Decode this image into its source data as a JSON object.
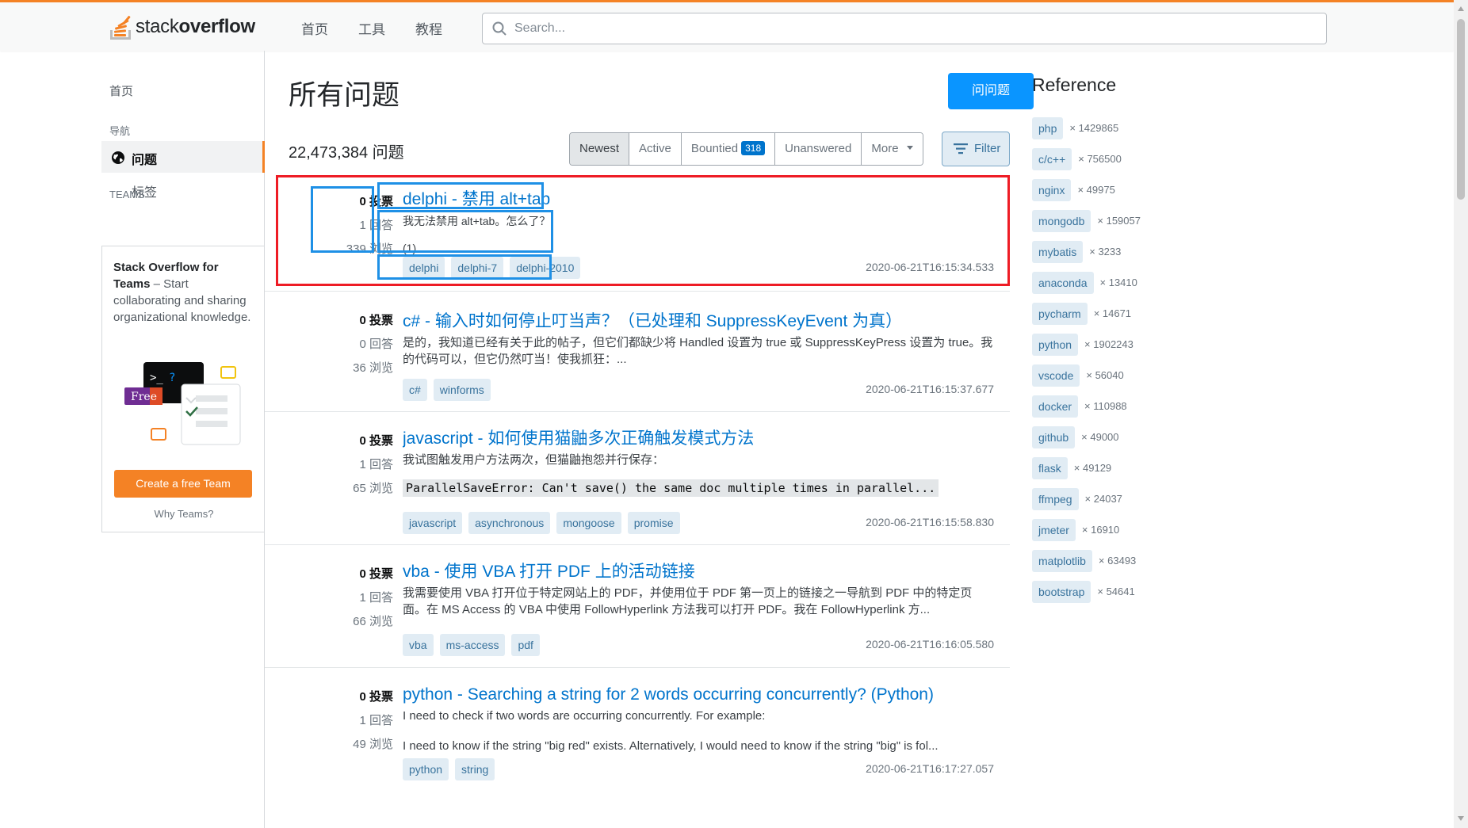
{
  "header": {
    "logo_text_1": "stack",
    "logo_text_2": "overflow",
    "nav": [
      "首页",
      "工具",
      "教程"
    ],
    "search_placeholder": "Search..."
  },
  "sidebar": {
    "home": "首页",
    "nav_section": "导航",
    "questions": "问题",
    "tags": "标签",
    "teams_section": "TEAMS",
    "teams_title": "Stack Overflow for Teams",
    "teams_desc": " – Start collaborating and sharing organizational knowledge.",
    "free_badge": "Free",
    "create_team": "Create a free Team",
    "why_teams": "Why Teams?"
  },
  "main": {
    "title": "所有问题",
    "ask_button": "问问题",
    "question_count": "22,473,384 问题",
    "filters": {
      "newest": "Newest",
      "active": "Active",
      "bountied": "Bountied",
      "bountied_count": "318",
      "unanswered": "Unanswered",
      "more": "More"
    },
    "filter_button": "Filter"
  },
  "questions": [
    {
      "votes": "0 投票",
      "answers": "1 回答",
      "views": "339 浏览",
      "title": "delphi - 禁用 alt+tab",
      "excerpt_1": "我无法禁用 alt+tab。怎么了？",
      "excerpt_2": "(1)...",
      "tags": [
        "delphi",
        "delphi-7",
        "delphi-2010"
      ],
      "date": "2020-06-21T16:15:34.533"
    },
    {
      "votes": "0 投票",
      "answers": "0 回答",
      "views": "36 浏览",
      "title": "c# - 输入时如何停止叮当声？（已处理和 SuppressKeyEvent 为真）",
      "excerpt_1": "是的，我知道已经有关于此的帖子，但它们都缺少将 Handled 设置为 true 或 SuppressKeyPress 设置为 true。我的代码可以，但它仍然叮当！使我抓狂：...",
      "tags": [
        "c#",
        "winforms"
      ],
      "date": "2020-06-21T16:15:37.677"
    },
    {
      "votes": "0 投票",
      "answers": "1 回答",
      "views": "65 浏览",
      "title": "javascript - 如何使用猫鼬多次正确触发模式方法",
      "excerpt_1": "我试图触发用户方法两次，但猫鼬抱怨并行保存：",
      "code": "ParallelSaveError: Can't save() the same doc multiple times in parallel...",
      "tags": [
        "javascript",
        "asynchronous",
        "mongoose",
        "promise"
      ],
      "date": "2020-06-21T16:15:58.830"
    },
    {
      "votes": "0 投票",
      "answers": "1 回答",
      "views": "66 浏览",
      "title": "vba - 使用 VBA 打开 PDF 上的活动链接",
      "excerpt_1": "我需要使用 VBA 打开位于特定网站上的 PDF，并使用位于 PDF 第一页上的链接之一导航到 PDF 中的特定页面。在 MS Access 的 VBA 中使用 FollowHyperlink 方法我可以打开 PDF。我在 FollowHyperlink 方...",
      "tags": [
        "vba",
        "ms-access",
        "pdf"
      ],
      "date": "2020-06-21T16:16:05.580"
    },
    {
      "votes": "0 投票",
      "answers": "1 回答",
      "views": "49 浏览",
      "title": "python - Searching a string for 2 words occurring concurrently? (Python)",
      "excerpt_1": "I need to check if two words are occurring concurrently. For example:",
      "excerpt_2": "I need to know if the string \"big red\" exists. Alternatively, I would need to know if the string \"big\" is fol...",
      "tags": [
        "python",
        "string"
      ],
      "date": "2020-06-21T16:17:27.057"
    }
  ],
  "reference": {
    "title": "Reference",
    "items": [
      {
        "tag": "php",
        "count": "× 1429865"
      },
      {
        "tag": "c/c++",
        "count": "× 756500"
      },
      {
        "tag": "nginx",
        "count": "× 49975"
      },
      {
        "tag": "mongodb",
        "count": "× 159057"
      },
      {
        "tag": "mybatis",
        "count": "× 3233"
      },
      {
        "tag": "anaconda",
        "count": "× 13410"
      },
      {
        "tag": "pycharm",
        "count": "× 14671"
      },
      {
        "tag": "python",
        "count": "× 1902243"
      },
      {
        "tag": "vscode",
        "count": "× 56040"
      },
      {
        "tag": "docker",
        "count": "× 110988"
      },
      {
        "tag": "github",
        "count": "× 49000"
      },
      {
        "tag": "flask",
        "count": "× 49129"
      },
      {
        "tag": "ffmpeg",
        "count": "× 24037"
      },
      {
        "tag": "jmeter",
        "count": "× 16910"
      },
      {
        "tag": "matplotlib",
        "count": "× 63493"
      },
      {
        "tag": "bootstrap",
        "count": "× 54641"
      }
    ]
  },
  "colors": {
    "accent": "#f48225",
    "link": "#0074cc",
    "primary_button": "#0a95ff",
    "highlight_red": "#ee1c25",
    "highlight_blue": "#1e90e6"
  }
}
